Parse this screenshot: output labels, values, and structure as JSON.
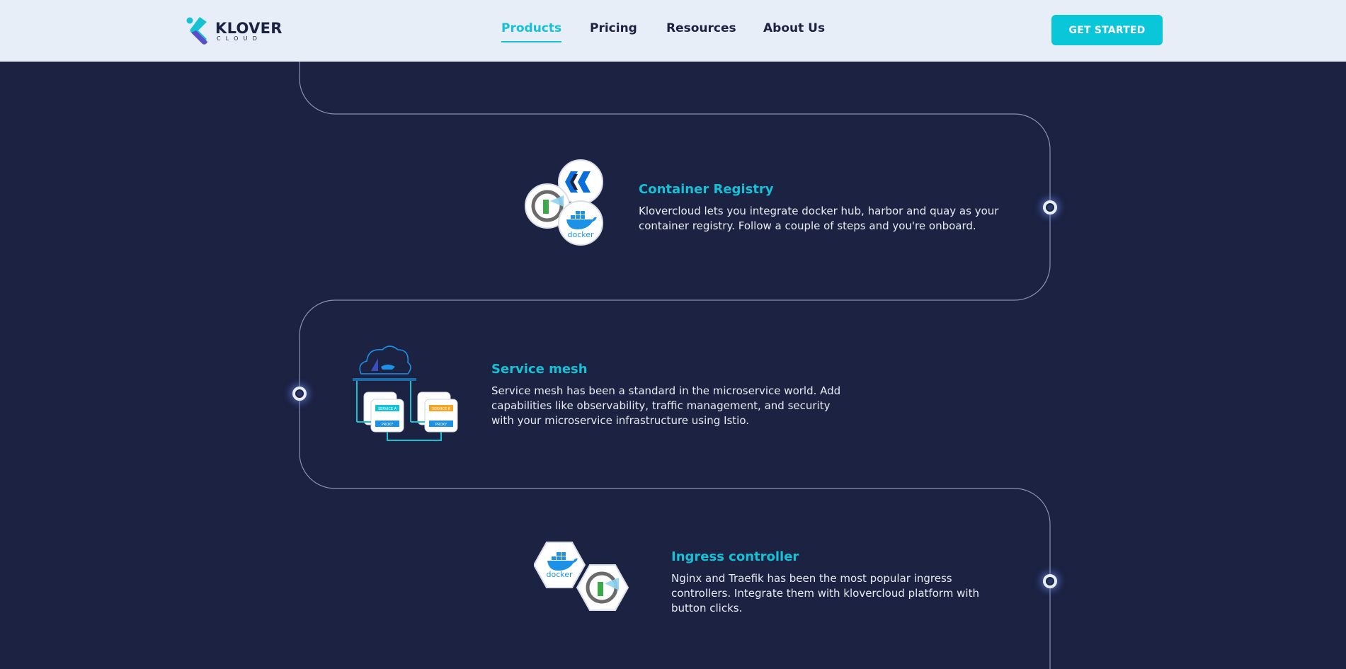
{
  "header": {
    "logo": {
      "word": "KLOVER",
      "sub": "CLOUD"
    },
    "nav": [
      {
        "label": "Products",
        "active": true
      },
      {
        "label": "Pricing",
        "active": false
      },
      {
        "label": "Resources",
        "active": false
      },
      {
        "label": "About Us",
        "active": false
      }
    ],
    "cta_label": "GET STARTED"
  },
  "features": [
    {
      "title": "Container Registry",
      "description": "Klovercloud lets you integrate docker hub, harbor and quay as your container registry. Follow a couple of steps and you're onboard."
    },
    {
      "title": "Service mesh",
      "description": "Service mesh has been a standard in the microservice world. Add capabilities like observability, traffic management, and security with your microservice infrastructure using Istio."
    },
    {
      "title": "Ingress controller",
      "description": "Nginx and Traefik has been the most popular ingress controllers. Integrate them with klovercloud platform with button clicks."
    }
  ],
  "illustration_text": {
    "docker": "docker",
    "service_a": "SERVICE A",
    "service_b": "SERVICE B",
    "proxy": "PROXY"
  },
  "colors": {
    "background": "#1b2242",
    "header_bg": "#e8eef8",
    "accent": "#16c1d6",
    "cta": "#0ac6d9"
  }
}
